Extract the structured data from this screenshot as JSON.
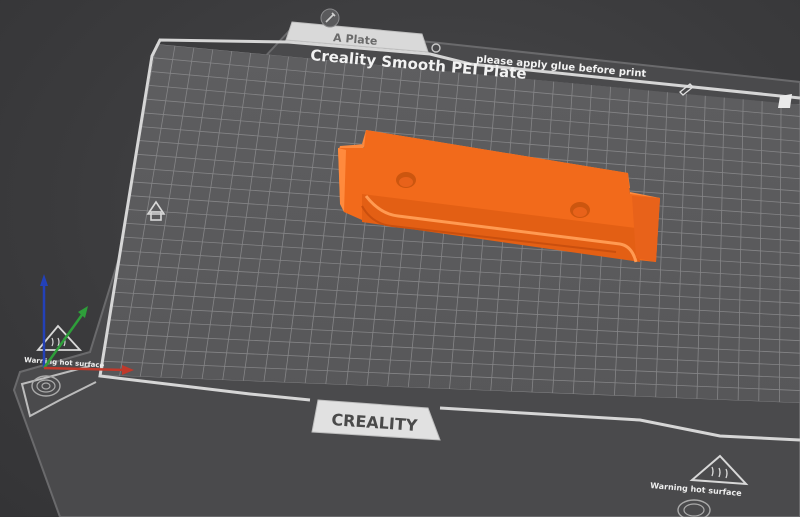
{
  "plate": {
    "tab_label": "A Plate",
    "title": "Creality Smooth PEI Plate",
    "glue_notice": "please apply glue before print",
    "brand": "CREALITY",
    "warning_left": "Warning hot surface",
    "warning_right": "Warning hot surface"
  },
  "colors": {
    "background": "#3a3a3c",
    "plate": "#5b5b5d",
    "grid": "#858587",
    "model": "#f26a1b",
    "axis_x": "#c0392b",
    "axis_y": "#2e9e3a",
    "axis_z": "#2341b8"
  },
  "icons": {
    "edit": "edit-icon",
    "tab_settings": "settings-icon",
    "home": "home-icon",
    "fingerprint": "fingerprint-icon",
    "hot_surface": "hot-surface-icon"
  }
}
